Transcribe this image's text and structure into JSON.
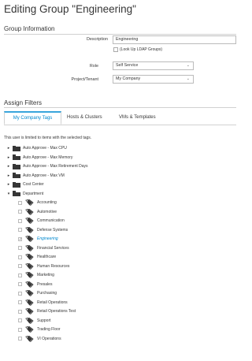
{
  "page": {
    "title": "Editing Group \"Engineering\"",
    "group_info_heading": "Group Information",
    "assign_filters_heading": "Assign Filters"
  },
  "form": {
    "description_label": "Description",
    "description_value": "Engineering",
    "ldap_checkbox_label": "(Look Up LDAP Groups)",
    "role_label": "Role",
    "role_value": "Self Service",
    "project_label": "Project/Tenant",
    "project_value": "My Company"
  },
  "tabs": [
    {
      "label": "My Company Tags",
      "active": true
    },
    {
      "label": "Hosts & Clusters",
      "active": false
    },
    {
      "label": "VMs & Templates",
      "active": false
    }
  ],
  "note": "This user is limited to items with the selected tags.",
  "categories": [
    {
      "label": "Auto Approve - Max CPU",
      "expanded": false
    },
    {
      "label": "Auto Approve - Max Memory",
      "expanded": false
    },
    {
      "label": "Auto Approve - Max Retirement Days",
      "expanded": false
    },
    {
      "label": "Auto Approve - Max VM",
      "expanded": false
    },
    {
      "label": "Cost Center",
      "expanded": false
    },
    {
      "label": "Department",
      "expanded": true
    }
  ],
  "department_tags": [
    {
      "label": "Accounting",
      "checked": false
    },
    {
      "label": "Automotive",
      "checked": false
    },
    {
      "label": "Communication",
      "checked": false
    },
    {
      "label": "Defense Systems",
      "checked": false
    },
    {
      "label": "Engineering",
      "checked": true
    },
    {
      "label": "Financial Services",
      "checked": false
    },
    {
      "label": "Healthcare",
      "checked": false
    },
    {
      "label": "Human Resources",
      "checked": false
    },
    {
      "label": "Marketing",
      "checked": false
    },
    {
      "label": "Presales",
      "checked": false
    },
    {
      "label": "Purchasing",
      "checked": false
    },
    {
      "label": "Retail Operations",
      "checked": false
    },
    {
      "label": "Retail Operations Test",
      "checked": false
    },
    {
      "label": "Support",
      "checked": false
    },
    {
      "label": "Trading Floor",
      "checked": false
    },
    {
      "label": "VI Operations",
      "checked": false
    }
  ],
  "colors": {
    "accent": "#0088ce",
    "tab_border_active": "#39a5dc",
    "text": "#363636"
  }
}
